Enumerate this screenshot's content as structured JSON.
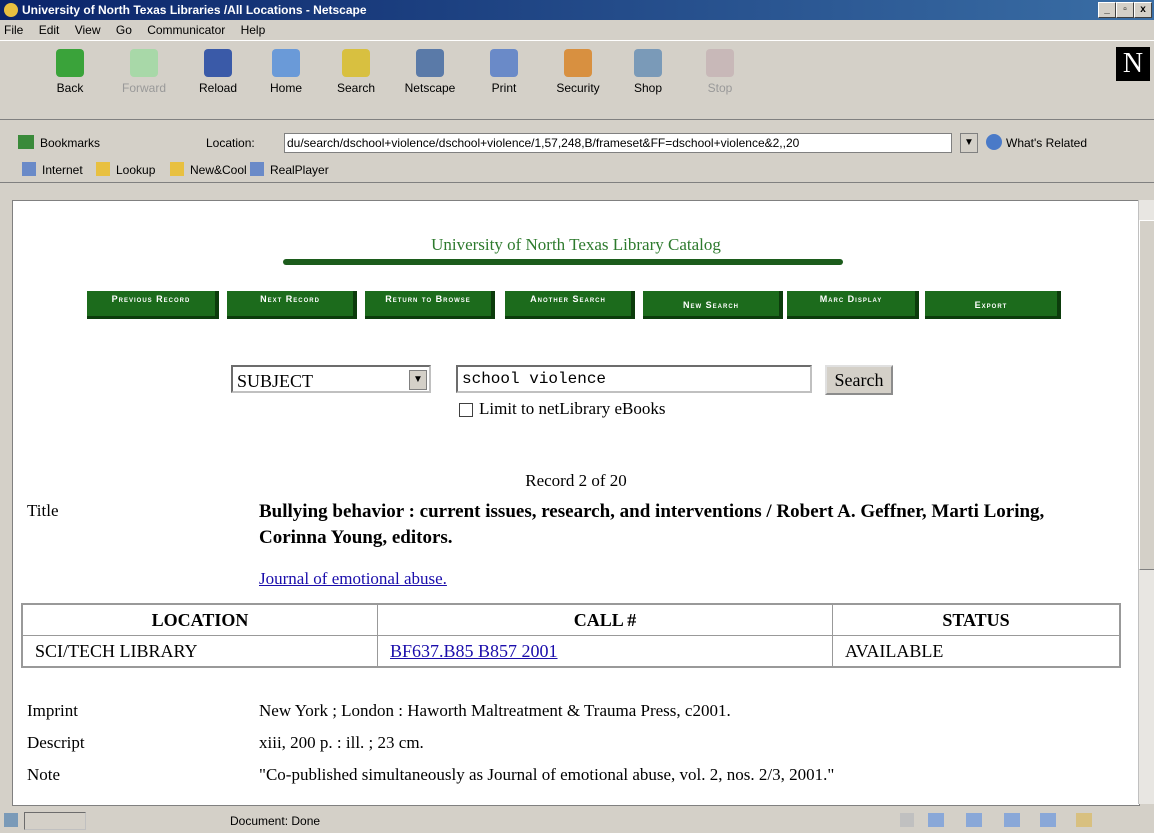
{
  "window": {
    "title": "University of North Texas Libraries /All Locations - Netscape",
    "min": "_",
    "max": "▫",
    "close": "x"
  },
  "menu": [
    "File",
    "Edit",
    "View",
    "Go",
    "Communicator",
    "Help"
  ],
  "nav_buttons": [
    {
      "label": "Back",
      "enabled": true
    },
    {
      "label": "Forward",
      "enabled": false
    },
    {
      "label": "Reload",
      "enabled": true
    },
    {
      "label": "Home",
      "enabled": true
    },
    {
      "label": "Search",
      "enabled": true
    },
    {
      "label": "Netscape",
      "enabled": true
    },
    {
      "label": "Print",
      "enabled": true
    },
    {
      "label": "Security",
      "enabled": true
    },
    {
      "label": "Shop",
      "enabled": true
    },
    {
      "label": "Stop",
      "enabled": false
    }
  ],
  "brand_logo": "N",
  "location": {
    "bookmarks_label": "Bookmarks",
    "location_label": "Location:",
    "url": "du/search/dschool+violence/dschool+violence/1,57,248,B/frameset&FF=dschool+violence&2,,20",
    "whats_related": "What's Related"
  },
  "personal_toolbar": [
    "Internet",
    "Lookup",
    "New&Cool",
    "RealPlayer"
  ],
  "page": {
    "catalog_title": "University of North Texas Library Catalog",
    "buttons": [
      "Previous Record",
      "Next Record",
      "Return to Browse",
      "Another Search",
      "New Search",
      "Marc Display",
      "Export"
    ],
    "search_type": "SUBJECT",
    "search_query": "school violence",
    "search_button": "Search",
    "limit_label": "Limit to netLibrary eBooks",
    "record_counter": "Record 2 of 20",
    "title_label": "Title",
    "title_value": "Bullying behavior : current issues, research, and interventions / Robert A. Geffner, Marti Loring, Corinna Young, editors.",
    "series_link": "Journal of emotional abuse.",
    "holdings": {
      "headers": [
        "LOCATION",
        "CALL #",
        "STATUS"
      ],
      "rows": [
        [
          "SCI/TECH LIBRARY",
          "BF637.B85 B857 2001",
          "AVAILABLE"
        ]
      ]
    },
    "fields": [
      {
        "label": "Imprint",
        "value": "New York ; London : Haworth Maltreatment & Trauma Press, c2001."
      },
      {
        "label": "Descript",
        "value": "xiii, 200 p. : ill. ; 23 cm."
      },
      {
        "label": "Note",
        "value": "\"Co-published simultaneously as Journal of emotional abuse, vol. 2, nos. 2/3, 2001.\""
      }
    ]
  },
  "status": {
    "text": "Document: Done"
  },
  "colors": {
    "green_button": "#1c6b1c",
    "title_green": "#2d7a2d",
    "link": "#1a0dab"
  }
}
